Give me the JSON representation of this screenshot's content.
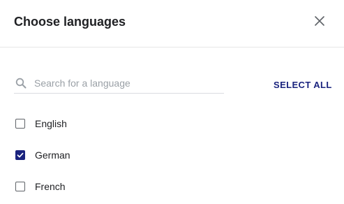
{
  "dialog": {
    "title": "Choose languages",
    "close_icon": "close-icon"
  },
  "search": {
    "placeholder": "Search for a language",
    "value": "",
    "icon": "search-icon"
  },
  "select_all_label": "SELECT ALL",
  "languages": [
    {
      "label": "English",
      "checked": false
    },
    {
      "label": "German",
      "checked": true
    },
    {
      "label": "French",
      "checked": false
    }
  ],
  "colors": {
    "accent": "#1a237e",
    "text": "#202124",
    "placeholder": "#9aa0a6",
    "divider": "#e6e6e6"
  }
}
